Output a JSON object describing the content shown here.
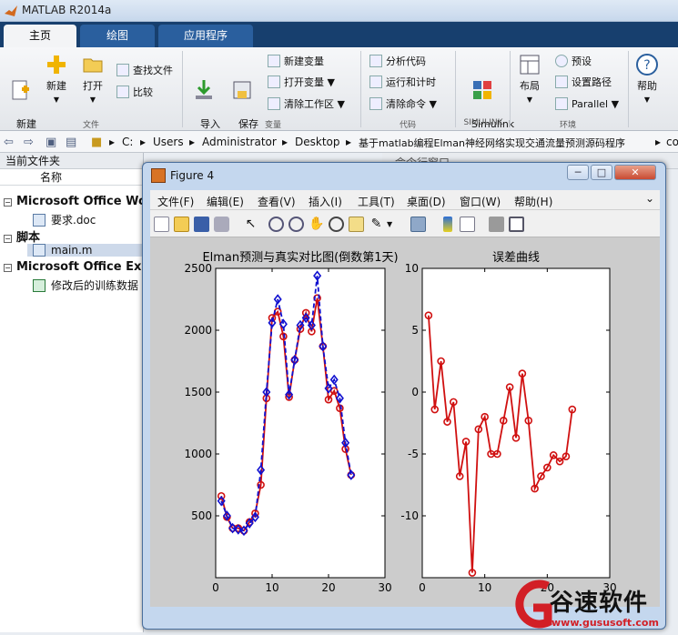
{
  "app": {
    "title": "MATLAB R2014a"
  },
  "tabs": [
    {
      "label": "主页"
    },
    {
      "label": "绘图"
    },
    {
      "label": "应用程序"
    }
  ],
  "ribbon": {
    "file": {
      "new_script": "新建\n脚本",
      "new": "新建",
      "open": "打开",
      "find_files": "查找文件",
      "compare": "比较",
      "group": "文件"
    },
    "variable": {
      "import": "导入\n数据",
      "save_ws": "保存\n工作区",
      "new_var": "新建变量",
      "open_var": "打开变量",
      "clear_ws": "清除工作区",
      "group": "变量"
    },
    "code": {
      "analyze": "分析代码",
      "run_time": "运行和计时",
      "clear_cmd": "清除命令",
      "group": "代码"
    },
    "simulink": {
      "lib": "Simulink\n库",
      "group": "SIMULINK"
    },
    "env": {
      "layout": "布局",
      "prefs": "预设",
      "set_path": "设置路径",
      "parallel": "Parallel",
      "group": "环境"
    },
    "help": {
      "label": "帮助"
    }
  },
  "address": {
    "crumbs": [
      "C:",
      "Users",
      "Administrator",
      "Desktop",
      "基于matlab编程Elman神经网络实现交通流量预测源码程序",
      "co"
    ]
  },
  "left_panel": {
    "title": "当前文件夹",
    "column": "名称",
    "groups": [
      {
        "name": "Microsoft Office Word",
        "files": [
          "要求.doc"
        ]
      },
      {
        "name": "脚本",
        "files": [
          "main.m"
        ]
      },
      {
        "name": "Microsoft Office Excel",
        "files": [
          "修改后的训练数据"
        ]
      }
    ]
  },
  "right_fragment": {
    "label": "命令行窗口"
  },
  "figure": {
    "title": "Figure 4",
    "menu": [
      "文件(F)",
      "编辑(E)",
      "查看(V)",
      "插入(I)",
      "工具(T)",
      "桌面(D)",
      "窗口(W)",
      "帮助(H)"
    ],
    "menu_arrow": "⌄"
  },
  "chart_data": [
    {
      "type": "line",
      "title": "Elman预测与真实对比图(倒数第1天)",
      "xlim": [
        0,
        30
      ],
      "ylim": [
        0,
        2500
      ],
      "xticks": [
        0,
        10,
        20,
        30
      ],
      "yticks": [
        500,
        1000,
        1500,
        2000,
        2500
      ],
      "x": [
        1,
        2,
        3,
        4,
        5,
        6,
        7,
        8,
        9,
        10,
        11,
        12,
        13,
        14,
        15,
        16,
        17,
        18,
        19,
        20,
        21,
        22,
        23,
        24
      ],
      "series": [
        {
          "color": "#d01010",
          "marker": "circle",
          "values": [
            660,
            490,
            400,
            400,
            380,
            450,
            520,
            750,
            1450,
            2100,
            2150,
            1950,
            1460,
            1760,
            2010,
            2140,
            1990,
            2260,
            1870,
            1440,
            1510,
            1370,
            1040,
            830
          ]
        },
        {
          "color": "#1010d0",
          "marker": "diamond",
          "values": [
            620,
            500,
            400,
            390,
            380,
            440,
            490,
            870,
            1500,
            2060,
            2250,
            2050,
            1480,
            1760,
            2040,
            2100,
            2040,
            2440,
            1870,
            1530,
            1600,
            1450,
            1090,
            830
          ]
        }
      ]
    },
    {
      "type": "line",
      "title": "误差曲线",
      "xlim": [
        0,
        30
      ],
      "ylim": [
        -15,
        10
      ],
      "xticks": [
        0,
        10,
        20,
        30
      ],
      "yticks": [
        10,
        5,
        0,
        -5,
        -10
      ],
      "x": [
        1,
        2,
        3,
        4,
        5,
        6,
        7,
        8,
        9,
        10,
        11,
        12,
        13,
        14,
        15,
        16,
        17,
        18,
        19,
        20,
        21,
        22,
        23,
        24
      ],
      "series": [
        {
          "color": "#d01010",
          "marker": "circle",
          "values": [
            6.2,
            -1.4,
            2.5,
            -2.4,
            -0.8,
            -6.8,
            -4,
            -14.6,
            -3,
            -2,
            -5,
            -5,
            -2.3,
            0.4,
            -3.7,
            1.5,
            -2.3,
            -7.8,
            -6.8,
            -6.1,
            -5.1,
            -5.6,
            -5.2,
            -1.4
          ]
        }
      ]
    }
  ],
  "watermark": {
    "brand": "谷速软件",
    "url": "www.gususoft.com",
    "color": "#d21f26"
  }
}
